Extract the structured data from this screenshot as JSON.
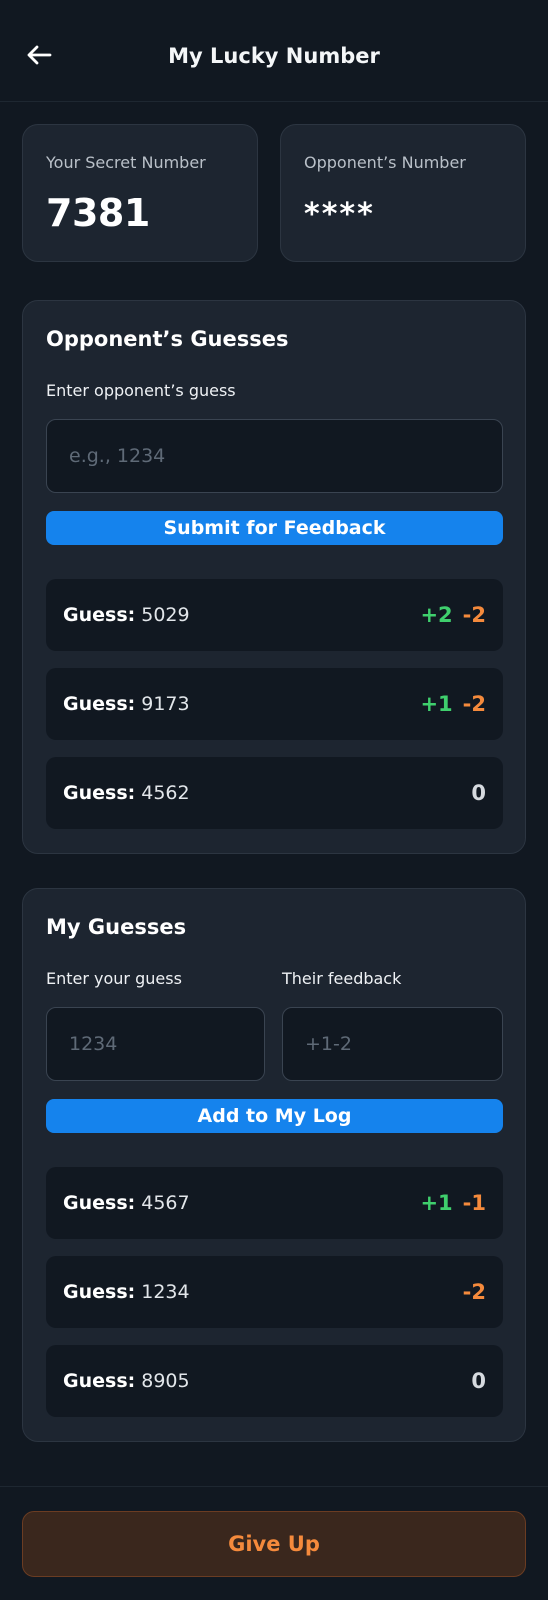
{
  "header": {
    "title": "My Lucky Number",
    "back_icon": "arrow-left-icon"
  },
  "secret": {
    "label": "Your Secret Number",
    "value": "7381"
  },
  "opponent": {
    "label": "Opponent’s Number",
    "value": "****"
  },
  "opponent_guesses": {
    "title": "Opponent’s Guesses",
    "input_label": "Enter opponent’s guess",
    "input_placeholder": "e.g., 1234",
    "submit_label": "Submit for Feedback",
    "rows": [
      {
        "prefix": "Guess:",
        "value": "5029",
        "plus": "+2",
        "minus": "-2",
        "zero": ""
      },
      {
        "prefix": "Guess:",
        "value": "9173",
        "plus": "+1",
        "minus": "-2",
        "zero": ""
      },
      {
        "prefix": "Guess:",
        "value": "4562",
        "plus": "",
        "minus": "",
        "zero": "0"
      }
    ]
  },
  "my_guesses": {
    "title": "My Guesses",
    "guess_label": "Enter your guess",
    "guess_placeholder": "1234",
    "feedback_label": "Their feedback",
    "feedback_placeholder": "+1-2",
    "add_label": "Add to My Log",
    "rows": [
      {
        "prefix": "Guess:",
        "value": "4567",
        "plus": "+1",
        "minus": "-1",
        "zero": ""
      },
      {
        "prefix": "Guess:",
        "value": "1234",
        "plus": "",
        "minus": "-2",
        "zero": ""
      },
      {
        "prefix": "Guess:",
        "value": "8905",
        "plus": "",
        "minus": "",
        "zero": "0"
      }
    ]
  },
  "footer": {
    "give_up_label": "Give Up"
  },
  "colors": {
    "accent": "#1583ed",
    "positive": "#3fcf6d",
    "negative": "#f58a3c"
  }
}
